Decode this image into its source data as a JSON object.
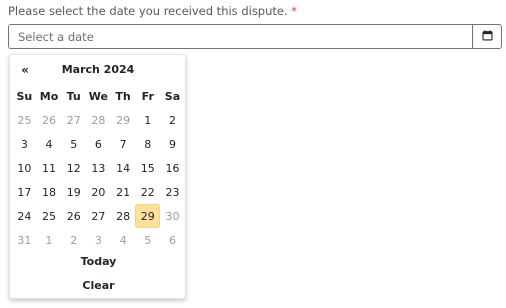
{
  "form": {
    "label": "Please select the date you received this dispute.",
    "required_marker": "*",
    "date_input": {
      "value": "",
      "placeholder": "Select a date"
    },
    "calendar_button_icon": "calendar-icon"
  },
  "datepicker": {
    "prev_label": "«",
    "month_title": "March 2024",
    "weekdays": [
      "Su",
      "Mo",
      "Tu",
      "We",
      "Th",
      "Fr",
      "Sa"
    ],
    "weeks": [
      [
        {
          "d": "25",
          "m": true
        },
        {
          "d": "26",
          "m": true
        },
        {
          "d": "27",
          "m": true
        },
        {
          "d": "28",
          "m": true
        },
        {
          "d": "29",
          "m": true
        },
        {
          "d": "1"
        },
        {
          "d": "2"
        }
      ],
      [
        {
          "d": "3"
        },
        {
          "d": "4"
        },
        {
          "d": "5"
        },
        {
          "d": "6"
        },
        {
          "d": "7"
        },
        {
          "d": "8"
        },
        {
          "d": "9"
        }
      ],
      [
        {
          "d": "10"
        },
        {
          "d": "11"
        },
        {
          "d": "12"
        },
        {
          "d": "13"
        },
        {
          "d": "14"
        },
        {
          "d": "15"
        },
        {
          "d": "16"
        }
      ],
      [
        {
          "d": "17"
        },
        {
          "d": "18"
        },
        {
          "d": "19"
        },
        {
          "d": "20"
        },
        {
          "d": "21"
        },
        {
          "d": "22"
        },
        {
          "d": "23"
        }
      ],
      [
        {
          "d": "24"
        },
        {
          "d": "25"
        },
        {
          "d": "26"
        },
        {
          "d": "27"
        },
        {
          "d": "28"
        },
        {
          "d": "29",
          "today": true
        },
        {
          "d": "30",
          "m": true
        }
      ],
      [
        {
          "d": "31",
          "m": true
        },
        {
          "d": "1",
          "m": true
        },
        {
          "d": "2",
          "m": true
        },
        {
          "d": "3",
          "m": true
        },
        {
          "d": "4",
          "m": true
        },
        {
          "d": "5",
          "m": true
        },
        {
          "d": "6",
          "m": true
        }
      ]
    ],
    "today_label": "Today",
    "clear_label": "Clear"
  },
  "colors": {
    "required": "#dc3545",
    "today_highlight": "#ffe09e",
    "muted_day": "#9a9da0",
    "border": "#6c757d"
  }
}
